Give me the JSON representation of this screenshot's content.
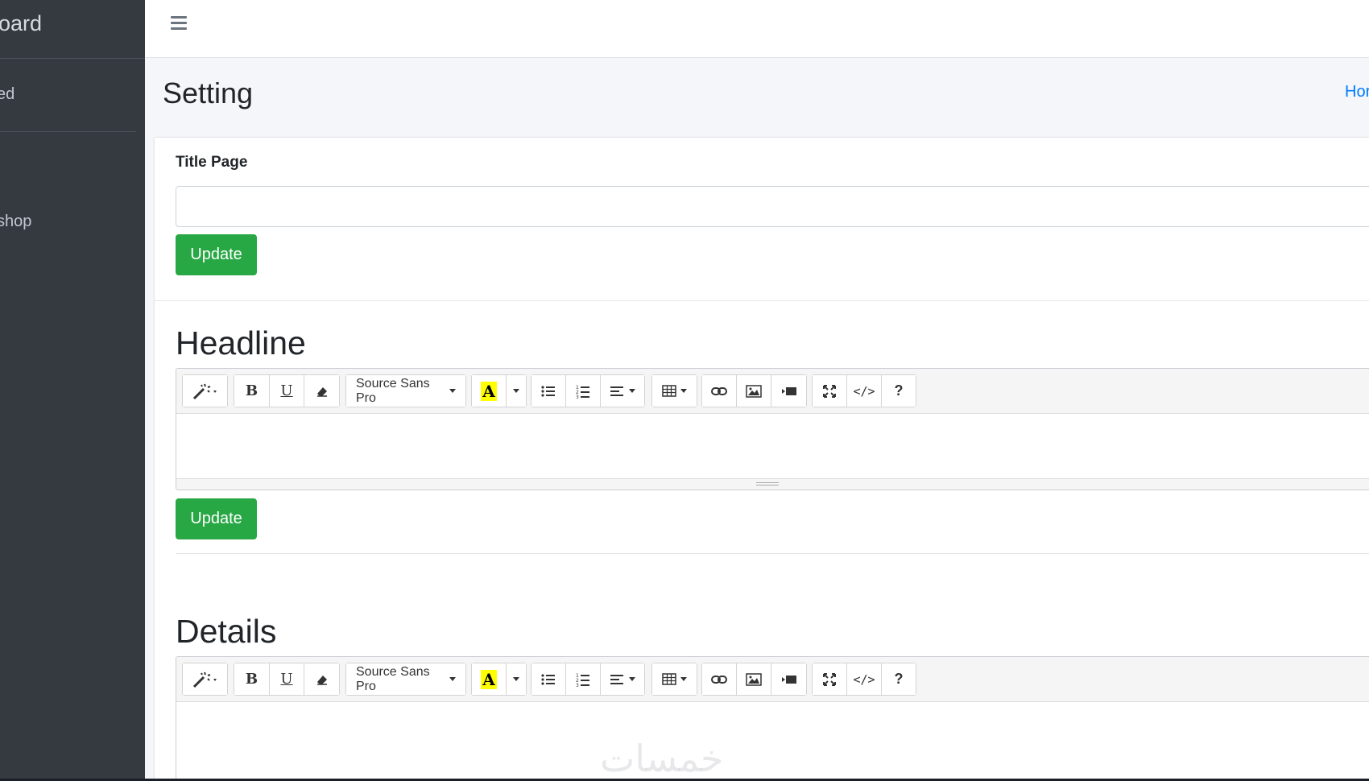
{
  "sidebar": {
    "brand": "oard",
    "user": "ed",
    "nav_item": "shop"
  },
  "breadcrumb": {
    "home": "Hor"
  },
  "page": {
    "title": "Setting"
  },
  "title_section": {
    "label": "Title Page",
    "value": "",
    "button": "Update"
  },
  "headline_section": {
    "heading": "Headline",
    "button": "Update"
  },
  "details_section": {
    "heading": "Details"
  },
  "editor_toolbar": {
    "font_name": "Source Sans Pro",
    "bold": "B",
    "underline": "U",
    "color_letter": "A",
    "codeview": "</>",
    "help": "?",
    "icons": [
      "magic-icon",
      "bold-icon",
      "underline-icon",
      "eraser-icon",
      "font-family-select",
      "text-color-icon",
      "unordered-list-icon",
      "ordered-list-icon",
      "align-icon",
      "table-icon",
      "link-icon",
      "picture-icon",
      "video-icon",
      "fullscreen-icon",
      "code-view-icon",
      "help-icon"
    ],
    "highlight_color": "#ffff00"
  },
  "colors": {
    "sidebar_bg": "#343a40",
    "accent": "#007bff",
    "success": "#28a745"
  },
  "watermark": "خمسات"
}
